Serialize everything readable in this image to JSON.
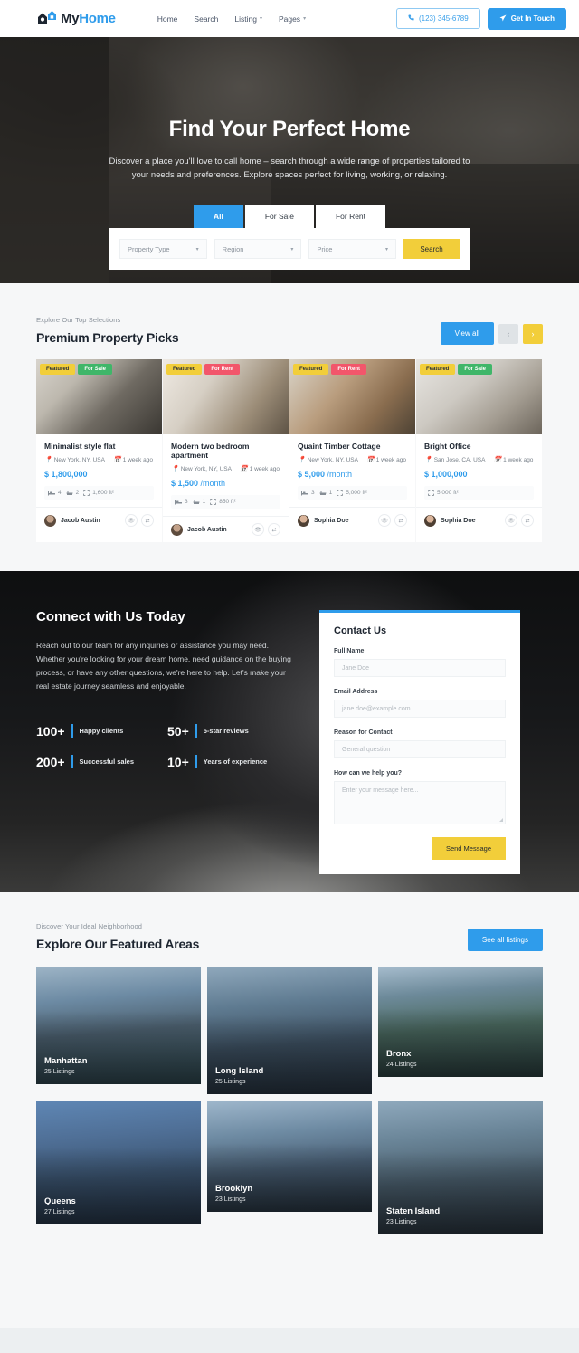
{
  "header": {
    "logo_text_dark": "My",
    "logo_text_blue": "Home",
    "logo_icon": "house-logo-icon",
    "nav": [
      {
        "label": "Home",
        "has_caret": false
      },
      {
        "label": "Search",
        "has_caret": false
      },
      {
        "label": "Listing",
        "has_caret": true
      },
      {
        "label": "Pages",
        "has_caret": true
      }
    ],
    "phone": "(123) 345-6789",
    "phone_icon": "phone-icon",
    "cta_label": "Get In Touch",
    "cta_icon": "paper-plane-icon"
  },
  "hero": {
    "title": "Find Your Perfect Home",
    "subtitle": "Discover a place you'll love to call home – search through a wide range of properties tailored to your needs and preferences. Explore spaces perfect for living, working, or relaxing.",
    "tabs": [
      {
        "label": "All",
        "active": true
      },
      {
        "label": "For Sale",
        "active": false
      },
      {
        "label": "For Rent",
        "active": false
      }
    ],
    "filters": [
      {
        "placeholder": "Property Type"
      },
      {
        "placeholder": "Region"
      },
      {
        "placeholder": "Price"
      }
    ],
    "search_label": "Search"
  },
  "picks": {
    "eyebrow": "Explore Our Top Selections",
    "title": "Premium Property Picks",
    "view_all_label": "View all",
    "prev_icon": "chevron-left-icon",
    "next_icon": "chevron-right-icon",
    "cards": [
      {
        "badges": [
          {
            "text": "Featured",
            "kind": "featured"
          },
          {
            "text": "For Sale",
            "kind": "sale"
          }
        ],
        "title": "Minimalist style flat",
        "location": "New York, NY, USA",
        "posted": "1 week ago",
        "price": "$ 1,800,000",
        "price_suffix": "",
        "beds": "4",
        "baths": "2",
        "area": "1,600 ft²",
        "agent": "Jacob Austin"
      },
      {
        "badges": [
          {
            "text": "Featured",
            "kind": "featured"
          },
          {
            "text": "For Rent",
            "kind": "rent"
          }
        ],
        "title": "Modern two bedroom apartment",
        "location": "New York, NY, USA",
        "posted": "1 week ago",
        "price": "$ 1,500",
        "price_suffix": " /month",
        "beds": "3",
        "baths": "1",
        "area": "850 ft²",
        "agent": "Jacob Austin"
      },
      {
        "badges": [
          {
            "text": "Featured",
            "kind": "featured"
          },
          {
            "text": "For Rent",
            "kind": "rent"
          }
        ],
        "title": "Quaint Timber Cottage",
        "location": "New York, NY, USA",
        "posted": "1 week ago",
        "price": "$ 5,000",
        "price_suffix": " /month",
        "beds": "3",
        "baths": "1",
        "area": "5,000 ft²",
        "agent": "Sophia Doe"
      },
      {
        "badges": [
          {
            "text": "Featured",
            "kind": "featured"
          },
          {
            "text": "For Sale",
            "kind": "sale"
          }
        ],
        "title": "Bright Office",
        "location": "San Jose, CA, USA",
        "posted": "1 week ago",
        "price": "$ 1,000,000",
        "price_suffix": "",
        "beds": "",
        "baths": "",
        "area": "5,000 ft²",
        "agent": "Sophia Doe"
      }
    ]
  },
  "connect": {
    "title": "Connect with Us Today",
    "text": "Reach out to our team for any inquiries or assistance you may need. Whether you're looking for your dream home, need guidance on the buying process, or have any other questions, we're here to help. Let's make your real estate journey seamless and enjoyable.",
    "stats": [
      {
        "value": "100+",
        "label": "Happy clients"
      },
      {
        "value": "50+",
        "label": "5-star reviews"
      },
      {
        "value": "200+",
        "label": "Successful sales"
      },
      {
        "value": "10+",
        "label": "Years of experience"
      }
    ],
    "form": {
      "title": "Contact Us",
      "fields": [
        {
          "label": "Full Name",
          "placeholder": "Jane Doe"
        },
        {
          "label": "Email Address",
          "placeholder": "jane.doe@example.com"
        },
        {
          "label": "Reason for Contact",
          "placeholder": "General question"
        }
      ],
      "message_label": "How can we help you?",
      "message_placeholder": "Enter your message here...",
      "submit_label": "Send Message"
    }
  },
  "areas": {
    "eyebrow": "Discover Your Ideal Neighborhood",
    "title": "Explore Our Featured Areas",
    "see_all_label": "See all listings",
    "items": [
      {
        "name": "Manhattan",
        "count": "25 Listings"
      },
      {
        "name": "Long Island",
        "count": "25 Listings"
      },
      {
        "name": "Bronx",
        "count": "24 Listings"
      },
      {
        "name": "Queens",
        "count": "27 Listings"
      },
      {
        "name": "Brooklyn",
        "count": "23 Listings"
      },
      {
        "name": "Staten Island",
        "count": "23 Listings"
      }
    ]
  },
  "colors": {
    "accent_blue": "#2f9ceb",
    "accent_yellow": "#f2ce3a",
    "sale_green": "#3fb669",
    "rent_red": "#f2566b",
    "pin_red": "#ef4b5e"
  }
}
